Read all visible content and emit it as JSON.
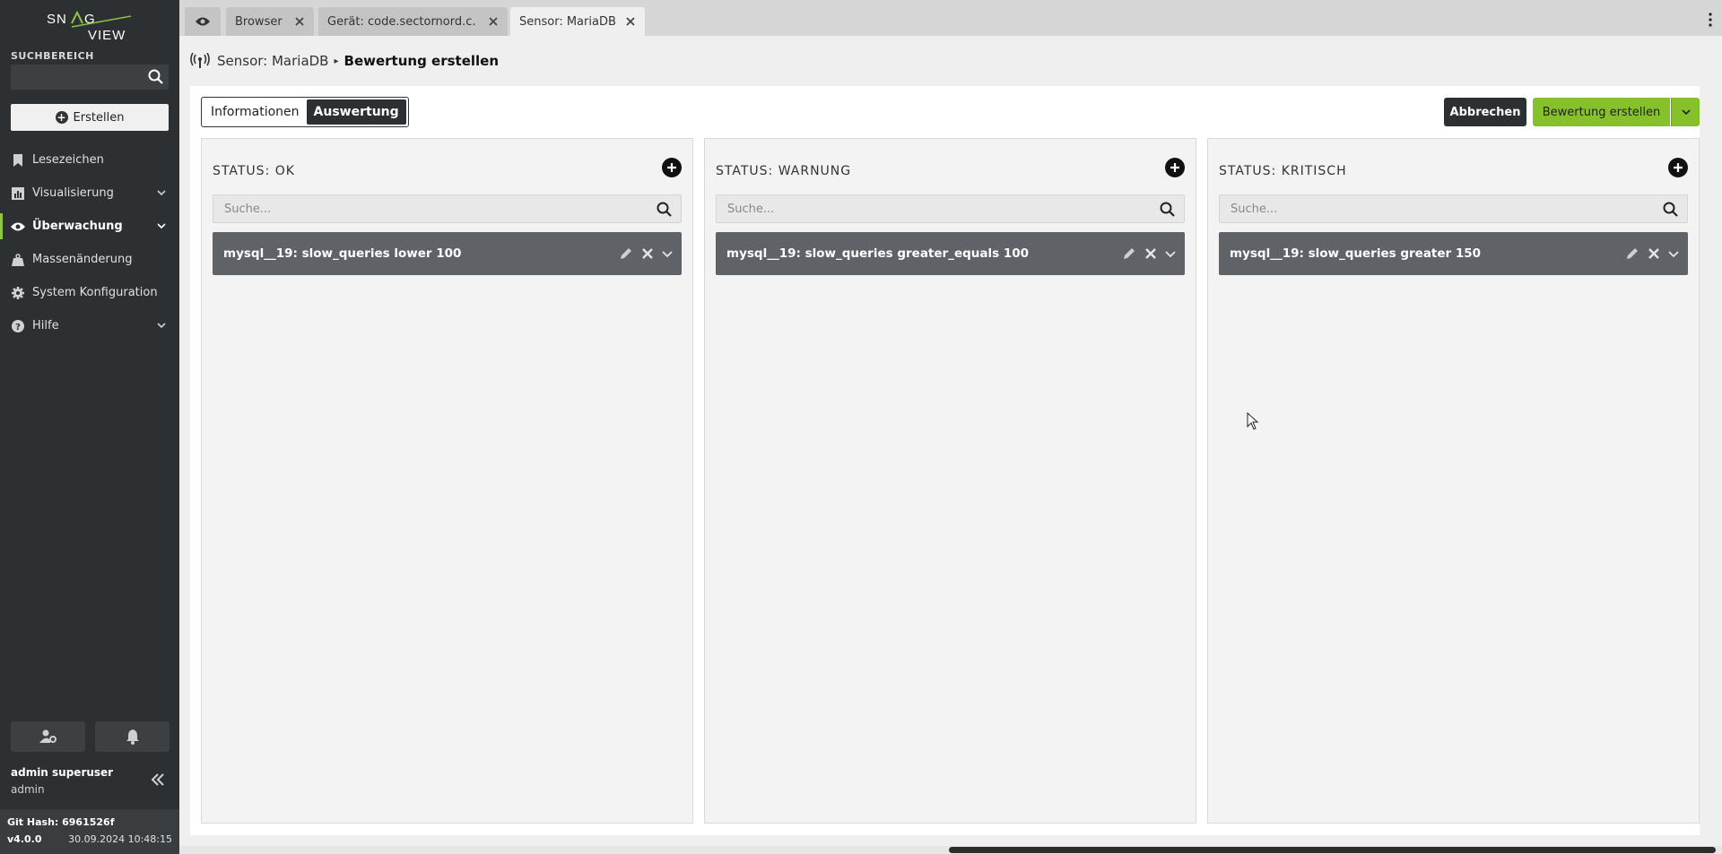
{
  "sidebar": {
    "logo_text": [
      "SN",
      "G",
      "VIEW"
    ],
    "search_label": "SUCHBEREICH",
    "create_label": "Erstellen",
    "items": [
      {
        "label": "Lesezeichen",
        "icon": "bookmark-icon",
        "has_chevron": false,
        "active": false
      },
      {
        "label": "Visualisierung",
        "icon": "chart-icon",
        "has_chevron": true,
        "active": false
      },
      {
        "label": "Überwachung",
        "icon": "eye-icon",
        "has_chevron": true,
        "active": true
      },
      {
        "label": "Massenänderung",
        "icon": "weight-icon",
        "has_chevron": false,
        "active": false
      },
      {
        "label": "System Konfiguration",
        "icon": "gear-icon",
        "has_chevron": false,
        "active": false
      },
      {
        "label": "Hilfe",
        "icon": "help-icon",
        "has_chevron": true,
        "active": false
      }
    ],
    "user_name": "admin superuser",
    "user_role": "admin",
    "git_hash": "Git Hash: 6961526f",
    "version": "v4.0.0",
    "build_date": "30.09.2024 10:48:15"
  },
  "tabs": [
    {
      "label": "Browser",
      "closable": true,
      "active": false
    },
    {
      "label": "Gerät: code.sectornord.c...",
      "closable": true,
      "active": false
    },
    {
      "label": "Sensor: MariaDB",
      "closable": true,
      "active": true
    }
  ],
  "breadcrumb": {
    "parent": "Sensor: MariaDB",
    "current": "Bewertung erstellen"
  },
  "toggle": {
    "options": [
      "Informationen",
      "Auswertung"
    ],
    "selected": "Auswertung"
  },
  "actions": {
    "cancel_label": "Abbrechen",
    "create_label": "Bewertung erstellen"
  },
  "columns": [
    {
      "title": "STATUS: OK",
      "search_placeholder": "Suche...",
      "rules": [
        "mysql__19: slow_queries lower 100"
      ]
    },
    {
      "title": "STATUS: WARNUNG",
      "search_placeholder": "Suche...",
      "rules": [
        "mysql__19: slow_queries greater_equals 100"
      ]
    },
    {
      "title": "STATUS: KRITISCH",
      "search_placeholder": "Suche...",
      "rules": [
        "mysql__19: slow_queries greater 150"
      ]
    }
  ],
  "colors": {
    "sidebar_bg": "#2d3033",
    "accent_green": "#86c12c",
    "dark_button": "#2d3033",
    "rule_bg": "#5f6266"
  }
}
